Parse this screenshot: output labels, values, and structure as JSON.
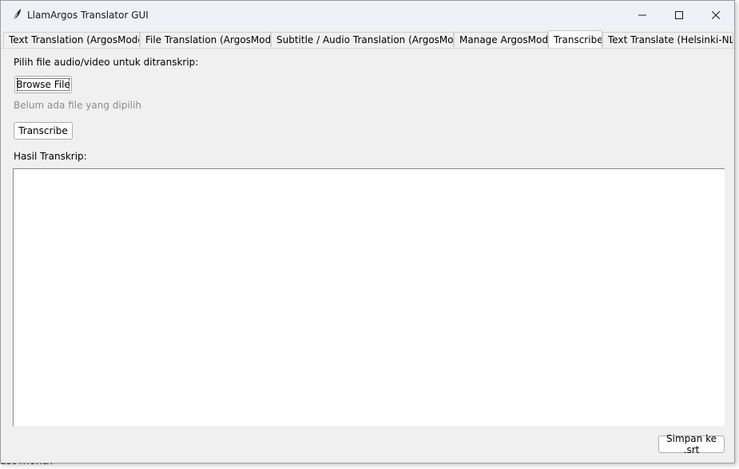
{
  "window": {
    "title": "LlamArgos Translator GUI",
    "controls": {
      "minimize": "minimize",
      "maximize": "maximize",
      "close": "close"
    }
  },
  "tabs": [
    {
      "label": "Text Translation (ArgosModel)",
      "active": false
    },
    {
      "label": "File Translation (ArgosModel)",
      "active": false
    },
    {
      "label": "Subtitle / Audio Translation (ArgosModel)",
      "active": false
    },
    {
      "label": "Manage ArgosModel",
      "active": false
    },
    {
      "label": "Transcriber",
      "active": true
    },
    {
      "label": "Text Translate (Helsinki-NLP)",
      "active": false
    }
  ],
  "transcriber": {
    "choose_label": "Pilih file audio/video untuk ditranskrip:",
    "browse_button": "Browse File",
    "file_status": "Belum ada file yang dipilih",
    "transcribe_button": "Transcribe",
    "result_label": "Hasil Transkrip:",
    "result_text": "",
    "save_button": "Simpan ke .srt"
  },
  "background": {
    "partial_text": "ast month"
  }
}
